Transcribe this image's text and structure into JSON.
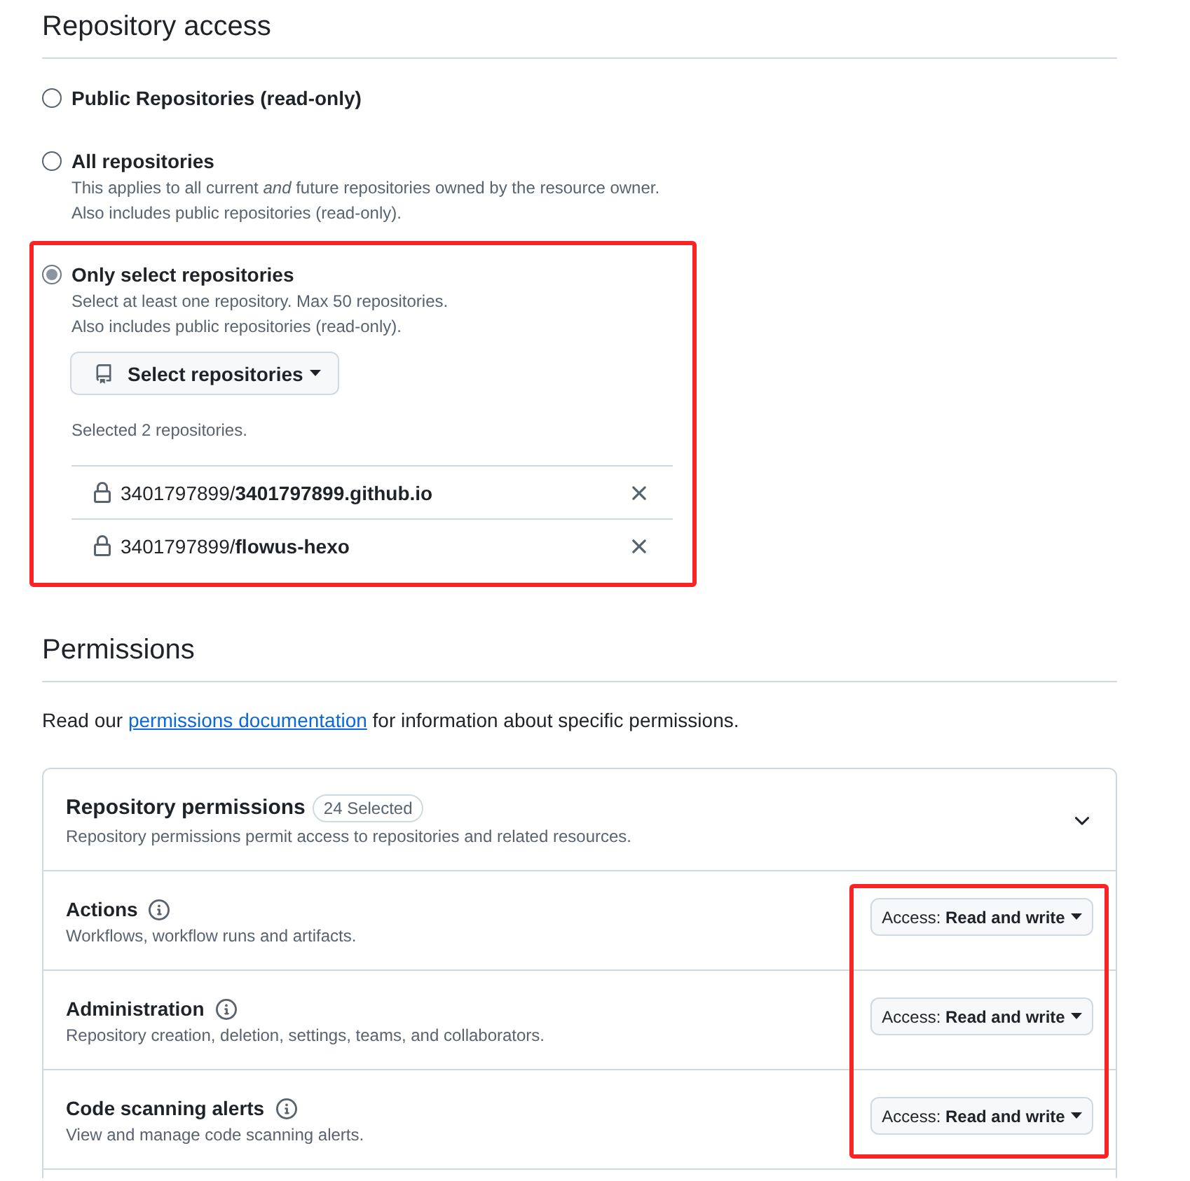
{
  "repository_access": {
    "title": "Repository access",
    "options": [
      {
        "label": "Public Repositories (read-only)",
        "selected": false,
        "highlighted": false
      },
      {
        "label": "All repositories",
        "description": [
          "This applies to all current *and* future repositories owned by the resource owner.",
          "Also includes public repositories (read-only)."
        ],
        "selected": false,
        "highlighted": false
      },
      {
        "label": "Only select repositories",
        "description": [
          "Select at least one repository. Max 50 repositories.",
          "Also includes public repositories (read-only)."
        ],
        "selected": true,
        "highlighted": true,
        "select_button": "Select repositories",
        "selected_count": "Selected 2 repositories.",
        "repositories": [
          {
            "name": "3401797899/**3401797899.github.io**"
          },
          {
            "name": "3401797899/**flowus-hexo**"
          }
        ]
      }
    ]
  },
  "permissions": {
    "title": "Permissions",
    "intro": {
      "text_before": "Read our",
      "link": "permissions documentation",
      "text_after": "for information about specific permissions."
    },
    "repository_permissions": {
      "title": "Repository permissions",
      "badge": "24 Selected",
      "description": "Repository permissions permit access to repositories and related resources.",
      "access_highlighted": true,
      "items": [
        {
          "name": "Actions",
          "description": "Workflows, workflow runs and artifacts.",
          "access": "Access: **Read and write**"
        },
        {
          "name": "Administration",
          "description": "Repository creation, deletion, settings, teams, and collaborators.",
          "access": "Access: **Read and write**"
        },
        {
          "name": "Code scanning alerts",
          "description": "View and manage code scanning alerts.",
          "access": "Access: **Read and write**"
        }
      ]
    }
  }
}
